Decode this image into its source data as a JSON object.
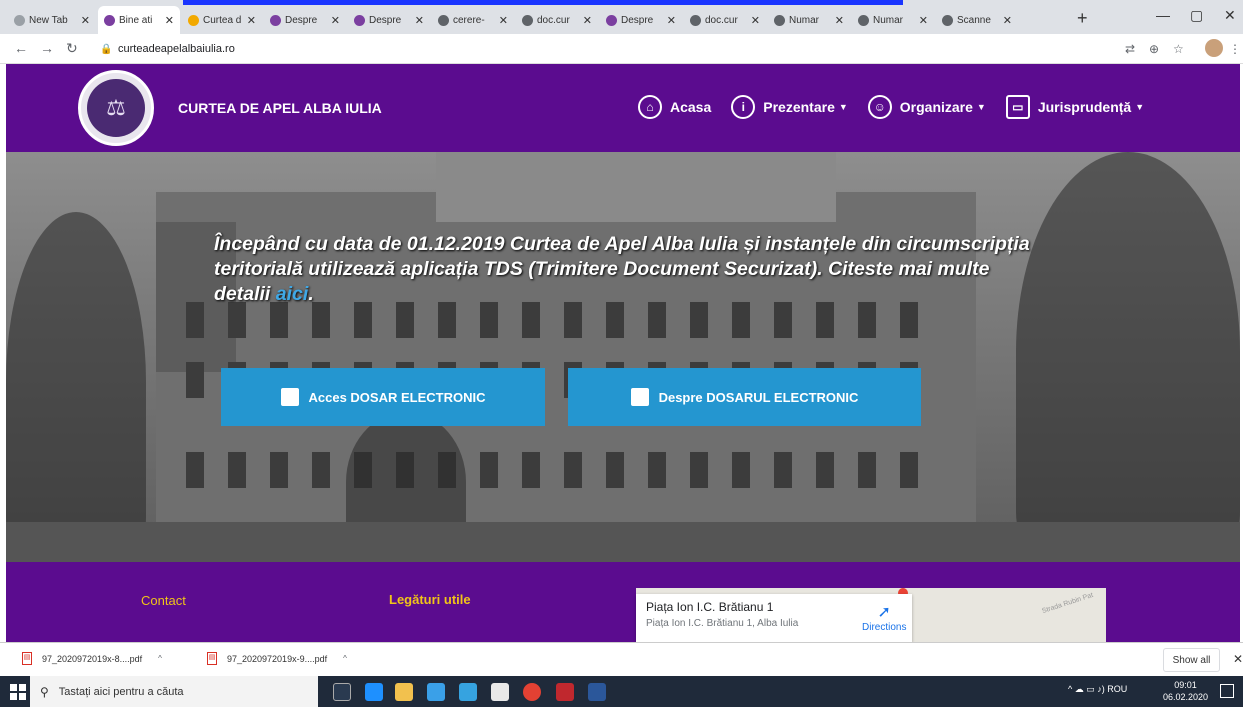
{
  "browser": {
    "tabs": [
      {
        "label": "New Tab",
        "fav": "#9aa0a6"
      },
      {
        "label": "Bine ati",
        "fav": "#7b3fa0",
        "active": true
      },
      {
        "label": "Curtea d",
        "fav": "#f2a900"
      },
      {
        "label": "Despre",
        "fav": "#7b3fa0"
      },
      {
        "label": "Despre",
        "fav": "#7b3fa0"
      },
      {
        "label": "cerere-",
        "fav": "#5f6368"
      },
      {
        "label": "doc.cur",
        "fav": "#5f6368"
      },
      {
        "label": "Despre",
        "fav": "#7b3fa0"
      },
      {
        "label": "doc.cur",
        "fav": "#5f6368"
      },
      {
        "label": "Numar",
        "fav": "#5f6368"
      },
      {
        "label": "Numar",
        "fav": "#5f6368"
      },
      {
        "label": "Scanne",
        "fav": "#5f6368"
      }
    ],
    "url": "curteadeapelalbaiulia.ro"
  },
  "site": {
    "brand": "CURTEA DE APEL ALBA IULIA",
    "nav": [
      {
        "label": "Acasa",
        "icon": "home-icon",
        "dropdown": false
      },
      {
        "label": "Prezentare",
        "icon": "info-icon",
        "dropdown": true
      },
      {
        "label": "Organizare",
        "icon": "people-icon",
        "dropdown": true
      },
      {
        "label": "Jurisprudență",
        "icon": "folder-icon",
        "dropdown": true
      }
    ],
    "notice_text": "Începând cu data de 01.12.2019 Curtea de Apel Alba Iulia și instanțele din circumscripția teritorială utilizează aplicația TDS (Trimitere Document Securizat). Citeste mai multe detalii ",
    "notice_link": "aici",
    "notice_end": ".",
    "btn_access": "Acces DOSAR ELECTRONIC",
    "btn_about": "Despre DOSARUL ELECTRONIC",
    "footer_contact": "Contact",
    "footer_links": "Legături utile",
    "map_title": "Piața Ion I.C. Brătianu 1",
    "map_address": "Piața Ion I.C. Brătianu 1, Alba Iulia",
    "map_directions": "Directions",
    "map_street": "Strada Rubin Pat"
  },
  "downloads": {
    "items": [
      "97_2020972019x-8....pdf",
      "97_2020972019x-9....pdf"
    ],
    "show_all": "Show all"
  },
  "taskbar": {
    "search_placeholder": "Tastați aici pentru a căuta",
    "lang": "ROU",
    "time": "09:01",
    "date": "06.02.2020"
  },
  "colors": {
    "header_purple": "#5b0c8f",
    "button_blue": "#2496d0",
    "footer_heading": "#f0c419"
  }
}
